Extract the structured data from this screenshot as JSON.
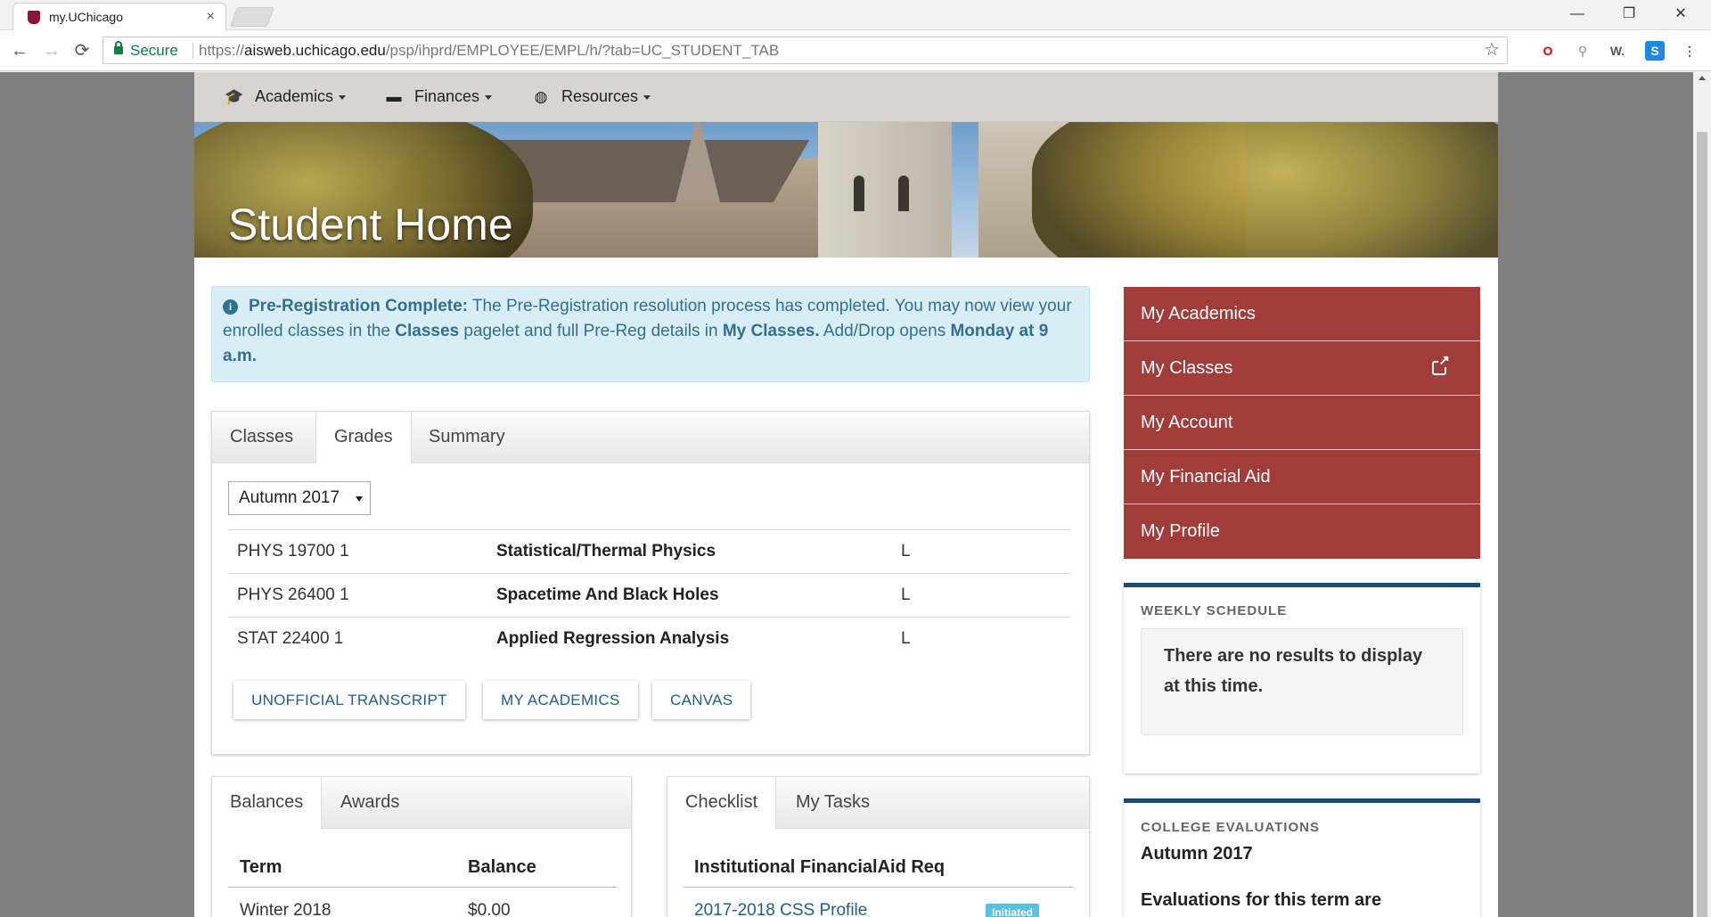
{
  "browser": {
    "tab_title": "my.UChicago",
    "tab_close": "×",
    "secure_label": "Secure",
    "url_scheme": "https://",
    "url_host": "aisweb.uchicago.edu",
    "url_path": "/psp/ihprd/EMPLOYEE/EMPL/h/?tab=UC_STUDENT_TAB",
    "window_controls": [
      "—",
      "❐",
      "✕"
    ],
    "nav": {
      "back": "←",
      "forward": "→",
      "reload": "⟳"
    },
    "star": "☆",
    "extensions": [
      "O",
      "⚲",
      "W.",
      "S",
      "⋮"
    ]
  },
  "topnav": {
    "items": [
      {
        "label": "Academics",
        "icon": "graduation-cap-icon",
        "glyph": "🎓"
      },
      {
        "label": "Finances",
        "icon": "credit-card-icon",
        "glyph": "▬"
      },
      {
        "label": "Resources",
        "icon": "globe-icon",
        "glyph": "◍"
      }
    ]
  },
  "banner": {
    "title": "Student Home"
  },
  "alert": {
    "icon": "i",
    "bold1": "Pre-Registration Complete:",
    "text1": " The Pre-Registration resolution process has completed. You may now view your enrolled classes in the ",
    "bold2": "Classes",
    "text2": " pagelet and full Pre-Reg details in ",
    "bold3": "My Classes.",
    "text3": " Add/Drop opens ",
    "bold4": "Monday at 9 a.m."
  },
  "grades_panel": {
    "tabs": [
      "Classes",
      "Grades",
      "Summary"
    ],
    "term_select": "Autumn 2017",
    "rows": [
      {
        "course": "PHYS 19700 1",
        "title": "Statistical/Thermal Physics",
        "grade": "L"
      },
      {
        "course": "PHYS 26400 1",
        "title": "Spacetime And Black Holes",
        "grade": "L"
      },
      {
        "course": "STAT 22400 1",
        "title": "Applied Regression Analysis",
        "grade": "L"
      }
    ],
    "buttons": [
      "UNOFFICIAL TRANSCRIPT",
      "MY ACADEMICS",
      "CANVAS"
    ]
  },
  "balances_panel": {
    "tabs": [
      "Balances",
      "Awards"
    ],
    "headers": [
      "Term",
      "Balance"
    ],
    "rows": [
      {
        "term": "Winter 2018",
        "balance": "$0.00"
      }
    ]
  },
  "checklist_panel": {
    "tabs": [
      "Checklist",
      "My Tasks"
    ],
    "header": "Institutional FinancialAid Req",
    "rows": [
      {
        "item": "2017-2018 CSS Profile",
        "status": "Initiated"
      }
    ]
  },
  "side_menu": {
    "items": [
      "My Academics",
      "My Classes",
      "My Account",
      "My Financial Aid",
      "My Profile"
    ]
  },
  "weekly_schedule": {
    "heading": "WEEKLY SCHEDULE",
    "message": "There are no results to display at this time."
  },
  "college_evaluations": {
    "heading": "COLLEGE EVALUATIONS",
    "term": "Autumn 2017",
    "text": "Evaluations for this term are"
  },
  "colors": {
    "uchicago_maroon": "#a23c3a",
    "alert_bg": "#d9edf7",
    "alert_text": "#31708f",
    "link": "#1f5d8c",
    "box_border": "#1a4a6e",
    "badge": "#5bc0de"
  }
}
